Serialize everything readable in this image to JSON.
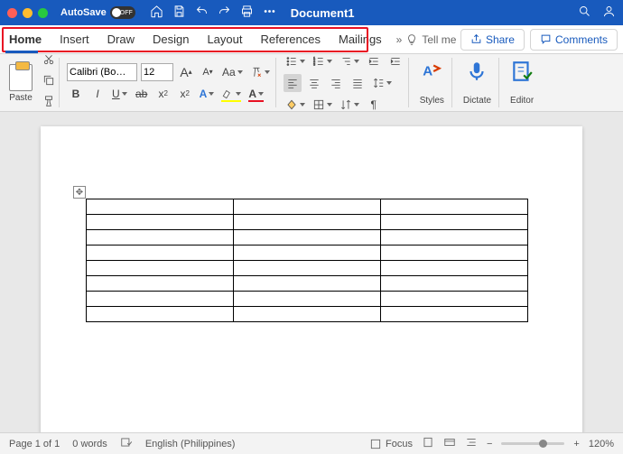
{
  "titlebar": {
    "autosave": "AutoSave",
    "autosave_state": "OFF",
    "doc": "Document1"
  },
  "tabs": [
    "Home",
    "Insert",
    "Draw",
    "Design",
    "Layout",
    "References",
    "Mailings"
  ],
  "tellme": "Tell me",
  "share": "Share",
  "comments": "Comments",
  "font": {
    "name": "Calibri (Bo…",
    "size": "12"
  },
  "paste": "Paste",
  "styles": "Styles",
  "dictate": "Dictate",
  "editor": "Editor",
  "status": {
    "page": "Page 1 of 1",
    "words": "0 words",
    "lang": "English (Philippines)",
    "focus": "Focus",
    "zoom": "120%"
  },
  "table": {
    "rows": 8,
    "cols": 3
  }
}
